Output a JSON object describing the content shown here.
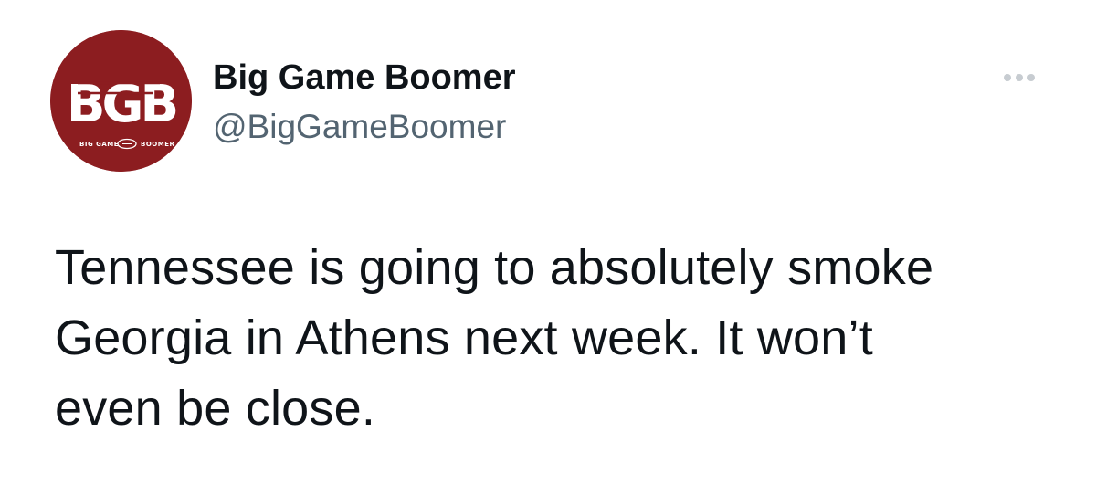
{
  "author": {
    "display_name": "Big Game Boomer",
    "handle": "@BigGameBoomer",
    "avatar": {
      "monogram": "BGB",
      "left_text": "BIG GAME",
      "right_text": "BOOMER",
      "background": "#8c1d20",
      "foreground": "#ffffff"
    }
  },
  "more_icon": "more-horizontal-icon",
  "tweet": {
    "text": "Tennessee is going to absolutely smoke\nGeorgia in Athens next week.  It won’t\neven be close."
  },
  "colors": {
    "text_primary": "#0f1419",
    "text_secondary": "#536471",
    "icon_muted": "#c7ccd1"
  }
}
